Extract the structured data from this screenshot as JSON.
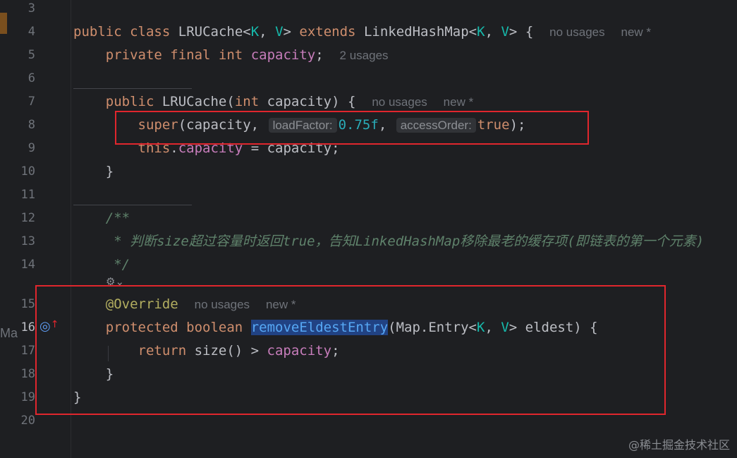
{
  "line_numbers": [
    "3",
    "4",
    "5",
    "6",
    "7",
    "8",
    "9",
    "10",
    "11",
    "12",
    "13",
    "14",
    "15",
    "16",
    "17",
    "18",
    "19",
    "20"
  ],
  "code": {
    "l4": {
      "kw_public": "public",
      "kw_class": "class",
      "name": "LRUCache",
      "lt": "<",
      "K": "K",
      "comma": ", ",
      "V": "V",
      "gt": ">",
      "kw_extends": "extends",
      "parent": "LinkedHashMap",
      "rest": " {"
    },
    "l4_hint_usages": "no usages",
    "l4_hint_new": "new *",
    "l5": {
      "kw": "private final int",
      "field": "capacity",
      "semi": ";"
    },
    "l5_hint": "2 usages",
    "l7": {
      "kw_public": "public",
      "name": "LRUCache",
      "open": "(",
      "kw_int": "int",
      "param": " capacity) {"
    },
    "l7_hint_usages": "no usages",
    "l7_hint_new": "new *",
    "l8": {
      "kw_super": "super",
      "open": "(capacity, ",
      "inlay_load": "loadFactor:",
      "num": "0.75f",
      "comma": ", ",
      "inlay_access": "accessOrder:",
      "kw_true": "true",
      "close": ");"
    },
    "l9": {
      "kw_this": "this",
      "dot": ".",
      "field": "capacity",
      "rest": " = capacity;"
    },
    "l10": "}",
    "l12": "/**",
    "l13": " * 判断size超过容量时返回true，告知LinkedHashMap移除最老的缓存项(即链表的第一个元素)",
    "l14": " */",
    "l15_ann": "@Override",
    "l15_hint_usages": "no usages",
    "l15_hint_new": "new *",
    "l16": {
      "kw": "protected boolean",
      "method": "removeEldestEntry",
      "open": "(Map.Entry<",
      "K": "K",
      "comma": ", ",
      "V": "V",
      "rest": "> eldest) {"
    },
    "l17": {
      "kw_return": "return",
      "call": " size() > ",
      "field": "capacity",
      "semi": ";"
    },
    "l18": "}",
    "l19": "}"
  },
  "side_fragment": "Ma",
  "inline_icon": "⚙⌄",
  "watermark": "@稀土掘金技术社区",
  "colors": {
    "accent_box": "#e0262d",
    "keyword": "#cf8e6d",
    "field": "#c77dbb",
    "number": "#2aacb8",
    "comment": "#5f826b",
    "annotation": "#b3ae60",
    "type_param": "#16baac"
  }
}
